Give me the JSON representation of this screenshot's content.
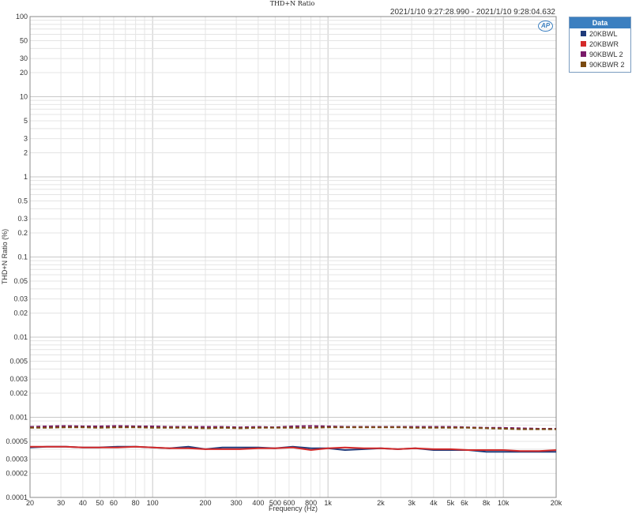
{
  "timestamp": "2021/1/10 9:27:28.990 - 2021/1/10 9:28:04.632",
  "legend": {
    "title": "Data",
    "items": [
      {
        "label": "20KBWL",
        "color": "#1f3a7a"
      },
      {
        "label": "20KBWR",
        "color": "#d42a2a"
      },
      {
        "label": "90KBWL 2",
        "color": "#7a1a6a"
      },
      {
        "label": "90KBWR 2",
        "color": "#7a4a10"
      }
    ]
  },
  "logo": "AP",
  "chart_data": {
    "type": "line",
    "title": "THD+N Ratio",
    "xlabel": "Frequency (Hz)",
    "ylabel": "THD+N Ratio (%)",
    "x_scale": "log",
    "y_scale": "log",
    "xlim": [
      20,
      20000
    ],
    "ylim": [
      0.0001,
      100
    ],
    "grid": true,
    "legend_position": "top-right",
    "x_ticks": [
      {
        "value": 20,
        "label": "20"
      },
      {
        "value": 30,
        "label": "30"
      },
      {
        "value": 40,
        "label": "40"
      },
      {
        "value": 50,
        "label": "50"
      },
      {
        "value": 60,
        "label": "60"
      },
      {
        "value": 80,
        "label": "80"
      },
      {
        "value": 100,
        "label": "100"
      },
      {
        "value": 200,
        "label": "200"
      },
      {
        "value": 300,
        "label": "300"
      },
      {
        "value": 400,
        "label": "400"
      },
      {
        "value": 500,
        "label": "500"
      },
      {
        "value": 600,
        "label": "600"
      },
      {
        "value": 800,
        "label": "800"
      },
      {
        "value": 1000,
        "label": "1k"
      },
      {
        "value": 2000,
        "label": "2k"
      },
      {
        "value": 3000,
        "label": "3k"
      },
      {
        "value": 4000,
        "label": "4k"
      },
      {
        "value": 5000,
        "label": "5k"
      },
      {
        "value": 6000,
        "label": "6k"
      },
      {
        "value": 8000,
        "label": "8k"
      },
      {
        "value": 10000,
        "label": "10k"
      },
      {
        "value": 20000,
        "label": "20k"
      }
    ],
    "y_ticks": [
      {
        "value": 100,
        "label": "100"
      },
      {
        "value": 50,
        "label": "50"
      },
      {
        "value": 30,
        "label": "30"
      },
      {
        "value": 20,
        "label": "20"
      },
      {
        "value": 10,
        "label": "10"
      },
      {
        "value": 5,
        "label": "5"
      },
      {
        "value": 3,
        "label": "3"
      },
      {
        "value": 2,
        "label": "2"
      },
      {
        "value": 1,
        "label": "1"
      },
      {
        "value": 0.5,
        "label": "0.5"
      },
      {
        "value": 0.3,
        "label": "0.3"
      },
      {
        "value": 0.2,
        "label": "0.2"
      },
      {
        "value": 0.1,
        "label": "0.1"
      },
      {
        "value": 0.05,
        "label": "0.05"
      },
      {
        "value": 0.03,
        "label": "0.03"
      },
      {
        "value": 0.02,
        "label": "0.02"
      },
      {
        "value": 0.01,
        "label": "0.01"
      },
      {
        "value": 0.005,
        "label": "0.005"
      },
      {
        "value": 0.003,
        "label": "0.003"
      },
      {
        "value": 0.002,
        "label": "0.002"
      },
      {
        "value": 0.001,
        "label": "0.001"
      },
      {
        "value": 0.0005,
        "label": "0.0005"
      },
      {
        "value": 0.0003,
        "label": "0.0003"
      },
      {
        "value": 0.0002,
        "label": "0.0002"
      },
      {
        "value": 0.0001,
        "label": "0.0001"
      }
    ],
    "series": [
      {
        "name": "20KBWL",
        "color": "#1f3a7a",
        "dash": false,
        "x": [
          20,
          25,
          32,
          40,
          50,
          63,
          80,
          100,
          125,
          160,
          200,
          250,
          315,
          400,
          500,
          630,
          800,
          1000,
          1250,
          1600,
          2000,
          2500,
          3150,
          4000,
          5000,
          6300,
          8000,
          10000,
          12500,
          16000,
          20000
        ],
        "y": [
          0.00042,
          0.00043,
          0.00043,
          0.00042,
          0.00042,
          0.00043,
          0.00043,
          0.00042,
          0.00041,
          0.00043,
          0.0004,
          0.00042,
          0.00042,
          0.00042,
          0.00041,
          0.00043,
          0.00041,
          0.00041,
          0.00039,
          0.0004,
          0.00041,
          0.0004,
          0.00041,
          0.00039,
          0.00039,
          0.00039,
          0.00037,
          0.00037,
          0.00037,
          0.00037,
          0.00037
        ]
      },
      {
        "name": "20KBWR",
        "color": "#d42a2a",
        "dash": false,
        "x": [
          20,
          25,
          32,
          40,
          50,
          63,
          80,
          100,
          125,
          160,
          200,
          250,
          315,
          400,
          500,
          630,
          800,
          1000,
          1250,
          1600,
          2000,
          2500,
          3150,
          4000,
          5000,
          6300,
          8000,
          10000,
          12500,
          16000,
          20000
        ],
        "y": [
          0.00043,
          0.00043,
          0.00043,
          0.00042,
          0.00042,
          0.00042,
          0.00043,
          0.00042,
          0.00041,
          0.00041,
          0.0004,
          0.0004,
          0.0004,
          0.00041,
          0.00041,
          0.00042,
          0.00039,
          0.00041,
          0.00042,
          0.00041,
          0.00041,
          0.0004,
          0.00041,
          0.0004,
          0.0004,
          0.00039,
          0.00039,
          0.00039,
          0.00038,
          0.00038,
          0.00039
        ]
      },
      {
        "name": "90KBWL 2",
        "color": "#7a1a6a",
        "dash": true,
        "x": [
          20,
          25,
          32,
          40,
          50,
          63,
          80,
          100,
          125,
          160,
          200,
          250,
          315,
          400,
          500,
          630,
          800,
          1000,
          1250,
          1600,
          2000,
          2500,
          3150,
          4000,
          5000,
          6300,
          8000,
          10000,
          12500,
          16000,
          20000
        ],
        "y": [
          0.00076,
          0.00077,
          0.00078,
          0.00077,
          0.00077,
          0.00078,
          0.00077,
          0.00077,
          0.00076,
          0.00076,
          0.00076,
          0.00076,
          0.00075,
          0.00076,
          0.00075,
          0.00077,
          0.00078,
          0.00077,
          0.00076,
          0.00076,
          0.00076,
          0.00076,
          0.00076,
          0.00076,
          0.00076,
          0.00075,
          0.00074,
          0.00074,
          0.00073,
          0.00072,
          0.00072
        ]
      },
      {
        "name": "90KBWR 2",
        "color": "#7a4a10",
        "dash": true,
        "x": [
          20,
          25,
          32,
          40,
          50,
          63,
          80,
          100,
          125,
          160,
          200,
          250,
          315,
          400,
          500,
          630,
          800,
          1000,
          1250,
          1600,
          2000,
          2500,
          3150,
          4000,
          5000,
          6300,
          8000,
          10000,
          12500,
          16000,
          20000
        ],
        "y": [
          0.00074,
          0.00074,
          0.00075,
          0.00075,
          0.00074,
          0.00075,
          0.00075,
          0.00074,
          0.00074,
          0.00074,
          0.00073,
          0.00074,
          0.00073,
          0.00074,
          0.00074,
          0.00074,
          0.00074,
          0.00075,
          0.00075,
          0.00075,
          0.00075,
          0.00075,
          0.00074,
          0.00074,
          0.00074,
          0.00074,
          0.00073,
          0.00072,
          0.00071,
          0.00071,
          0.00071
        ]
      }
    ]
  }
}
